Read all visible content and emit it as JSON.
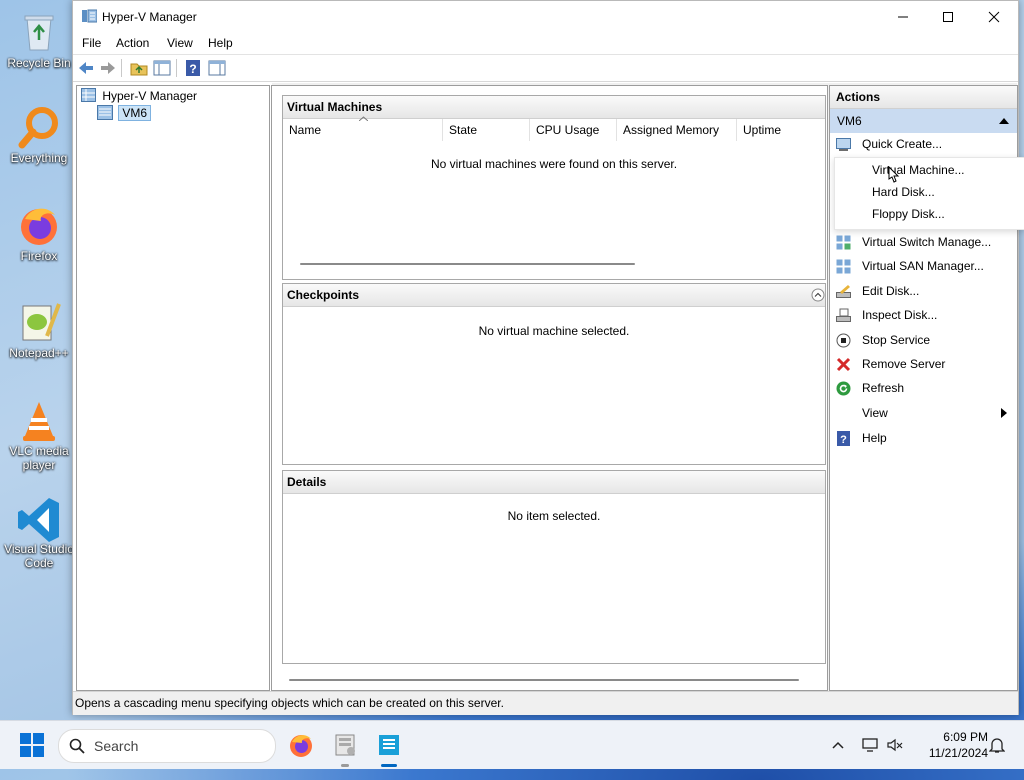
{
  "desktop": {
    "icons": [
      {
        "label": "Recycle Bin"
      },
      {
        "label": "Everything"
      },
      {
        "label": "Firefox"
      },
      {
        "label": "Notepad++"
      },
      {
        "label": "VLC media player"
      },
      {
        "label": "Visual Studio Code"
      }
    ]
  },
  "window": {
    "title": "Hyper-V Manager",
    "menu": [
      "File",
      "Action",
      "View",
      "Help"
    ]
  },
  "tree": {
    "root": "Hyper-V Manager",
    "child": "VM6"
  },
  "virtual_machines": {
    "header": "Virtual Machines",
    "columns": [
      "Name",
      "State",
      "CPU Usage",
      "Assigned Memory",
      "Uptime"
    ],
    "empty_message": "No virtual machines were found on this server."
  },
  "checkpoints": {
    "header": "Checkpoints",
    "empty_message": "No virtual machine selected."
  },
  "details": {
    "header": "Details",
    "empty_message": "No item selected."
  },
  "actions": {
    "header": "Actions",
    "section": "VM6",
    "items": [
      {
        "label": "Quick Create...",
        "icon": "quick-create-icon"
      },
      {
        "label": "Virtual Switch Manage...",
        "icon": "switch-icon"
      },
      {
        "label": "Virtual SAN Manager...",
        "icon": "san-icon"
      },
      {
        "label": "Edit Disk...",
        "icon": "edit-disk-icon"
      },
      {
        "label": "Inspect Disk...",
        "icon": "inspect-disk-icon"
      },
      {
        "label": "Stop Service",
        "icon": "stop-icon"
      },
      {
        "label": "Remove Server",
        "icon": "remove-icon"
      },
      {
        "label": "Refresh",
        "icon": "refresh-icon"
      },
      {
        "label": "View",
        "icon": ""
      },
      {
        "label": "Help",
        "icon": "help-icon"
      }
    ]
  },
  "new_submenu": {
    "items": [
      "Virtual Machine...",
      "Hard Disk...",
      "Floppy Disk..."
    ]
  },
  "status_bar": {
    "text": "Opens a cascading menu specifying objects which can be created on this server."
  },
  "taskbar": {
    "search_placeholder": "Search",
    "time": "6:09 PM",
    "date": "11/21/2024"
  },
  "colors": {
    "accent": "#0067c0",
    "selection": "#c9dbf1"
  }
}
